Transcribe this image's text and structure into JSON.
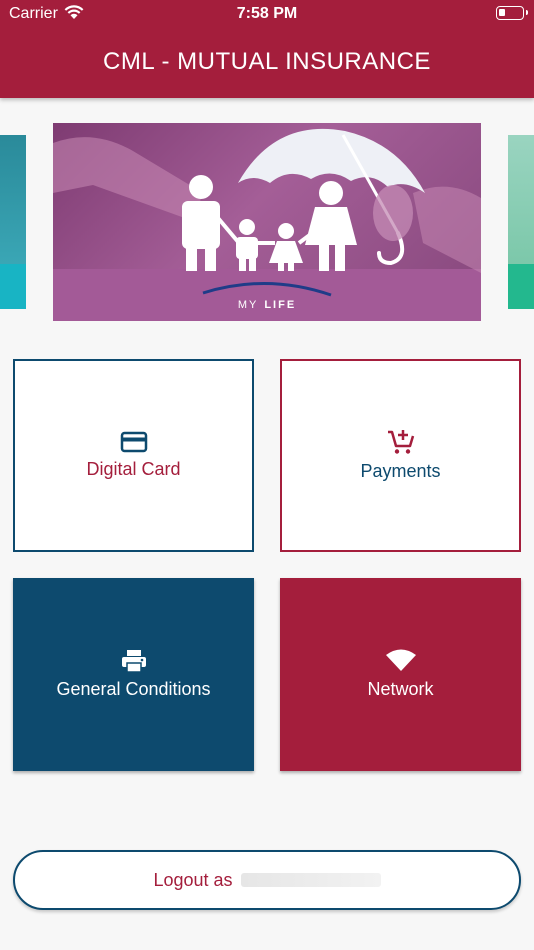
{
  "status_bar": {
    "carrier": "Carrier",
    "time": "7:58 PM",
    "battery_level": 0.3
  },
  "header": {
    "title": "CML - MUTUAL INSURANCE"
  },
  "carousel": {
    "banner": {
      "brand_left": "MY",
      "brand_right": "LIFE"
    }
  },
  "tiles": [
    {
      "label": "Digital Card",
      "icon": "credit-card-icon"
    },
    {
      "label": "Payments",
      "icon": "add-to-cart-icon"
    },
    {
      "label": "General Conditions",
      "icon": "printer-icon"
    },
    {
      "label": "Network",
      "icon": "wifi-icon"
    }
  ],
  "logout": {
    "label": "Logout as"
  },
  "colors": {
    "primary_red": "#a41e3c",
    "primary_blue": "#0d4a6e",
    "background": "#f7f7f7"
  }
}
